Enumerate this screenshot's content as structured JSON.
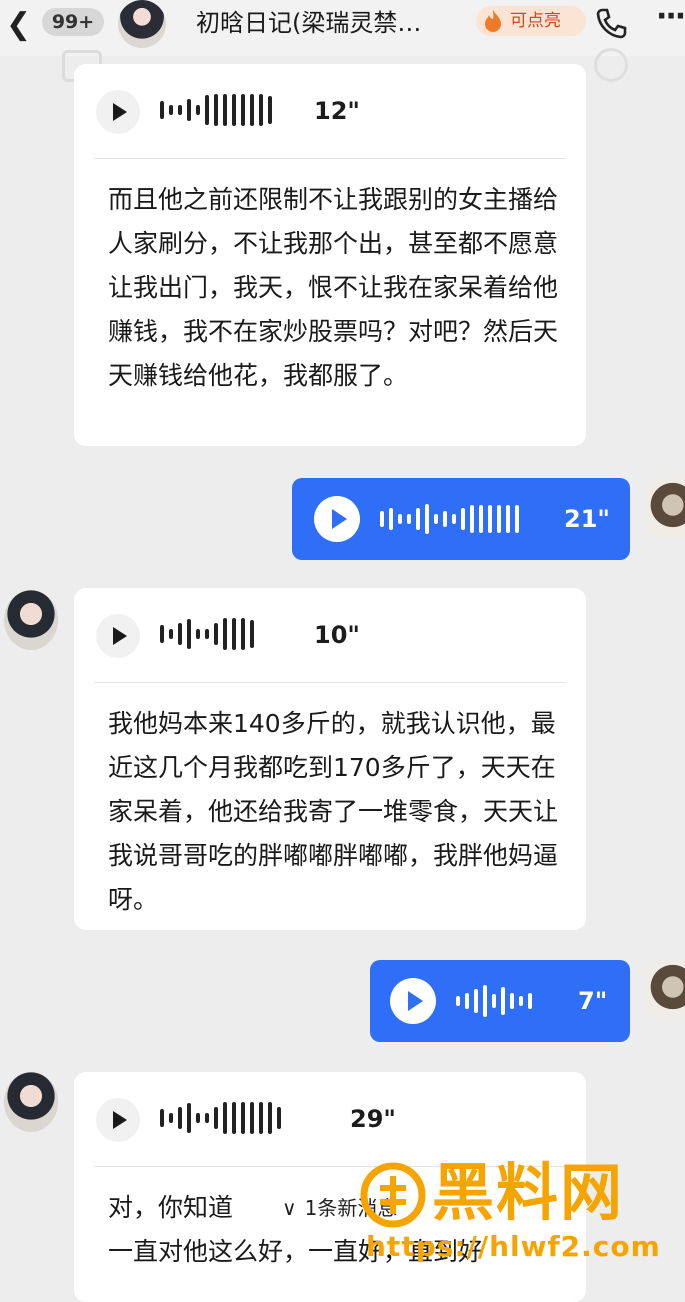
{
  "header": {
    "back_icon": "chevron-left-icon",
    "unread_badge": "99+",
    "title": "初晗日记(梁瑞灵禁…",
    "hot_label": "可点亮",
    "phone_icon": "phone-icon",
    "more_icon": "more-icon"
  },
  "messages": [
    {
      "direction": "incoming",
      "duration": "12\"",
      "transcript": "而且他之前还限制不让我跟别的女主播给人家刷分，不让我那个出，甚至都不愿意让我出门，我天，恨不让我在家呆着给他赚钱，我不在家炒股票吗？对吧？然后天天赚钱给他花，我都服了。"
    },
    {
      "direction": "outgoing",
      "duration": "21\""
    },
    {
      "direction": "incoming",
      "duration": "10\"",
      "transcript": "我他妈本来140多斤的，就我认识他，最近这几个月我都吃到170多斤了，天天在家呆着，他还给我寄了一堆零食，天天让我说哥哥吃的胖嘟嘟胖嘟嘟，我胖他妈逼呀。"
    },
    {
      "direction": "outgoing",
      "duration": "7\""
    },
    {
      "direction": "incoming",
      "duration": "29\"",
      "transcript_line1": "对，你知道",
      "transcript_line2": "一直对他这么好，一直好，直到好"
    }
  ],
  "new_message_pill": {
    "label": "1条新消息",
    "icon": "chevron-down-icon"
  },
  "watermark": {
    "brand": "黑料网",
    "url": "https://hlwf2.com"
  },
  "colors": {
    "outgoing_bubble": "#2f6ef6",
    "background": "#ededed",
    "watermark": "#f5a400"
  }
}
